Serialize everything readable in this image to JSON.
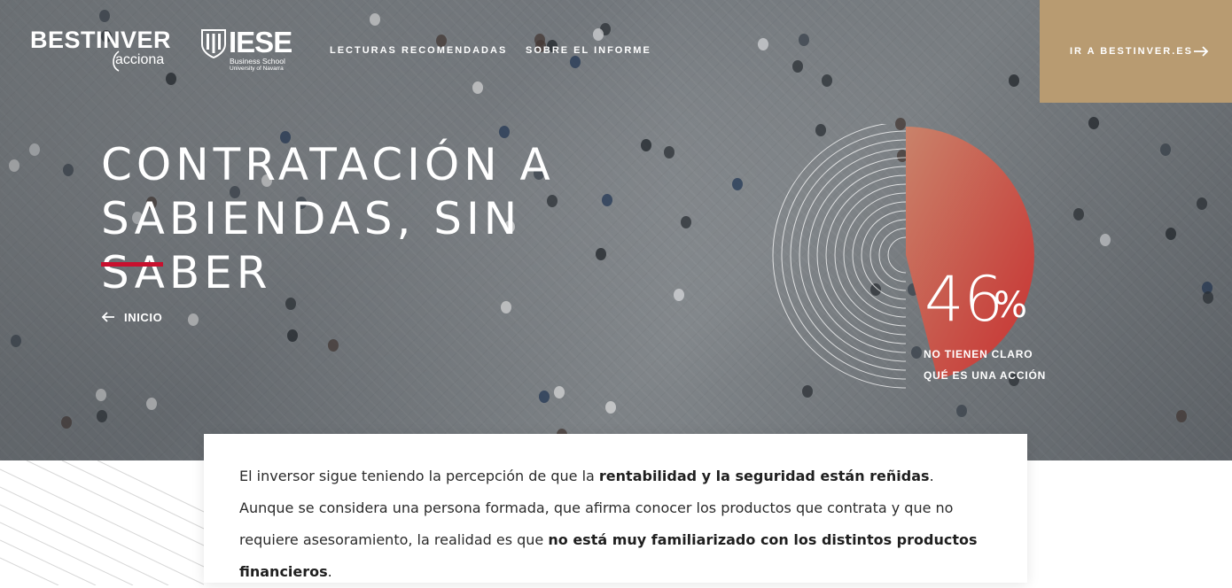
{
  "header": {
    "logo_bestinver": "BESTINVER",
    "logo_bestinver_sub": "acciona",
    "logo_iese": "IESE",
    "logo_iese_line1": "Business School",
    "logo_iese_line2": "University of Navarra",
    "nav": [
      {
        "label": "LECTURAS RECOMENDADAS"
      },
      {
        "label": "SOBRE EL INFORME"
      }
    ],
    "cta_label": "IR A BESTINVER.ES",
    "cta_icon": "arrow-right-icon"
  },
  "hero": {
    "title_line1": "CONTRATACIÓN A",
    "title_line2": "SABIENDAS, SIN SABER",
    "back_label": "INICIO",
    "back_icon": "arrow-left-icon"
  },
  "stat": {
    "value": "46",
    "unit": "%",
    "fraction": 0.46,
    "caption_line1": "NO TIENEN CLARO",
    "caption_line2": "QUÉ ES UNA ACCIÓN"
  },
  "intro": {
    "part1": "El inversor sigue teniendo la percepción de que la ",
    "bold1": "rentabilidad y la seguridad están reñidas",
    "part2": ". Aunque se considera una persona formada, que afirma conocer los productos que contrata y que no requiere asesoramiento, la realidad es que ",
    "bold2": "no está muy familiarizado con los distintos productos financieros",
    "part3": "."
  },
  "colors": {
    "accent_red": "#c8102e",
    "cta_gold": "#b89b71",
    "pie_gradient_start": "#c9826a",
    "pie_gradient_end": "#c83030"
  }
}
